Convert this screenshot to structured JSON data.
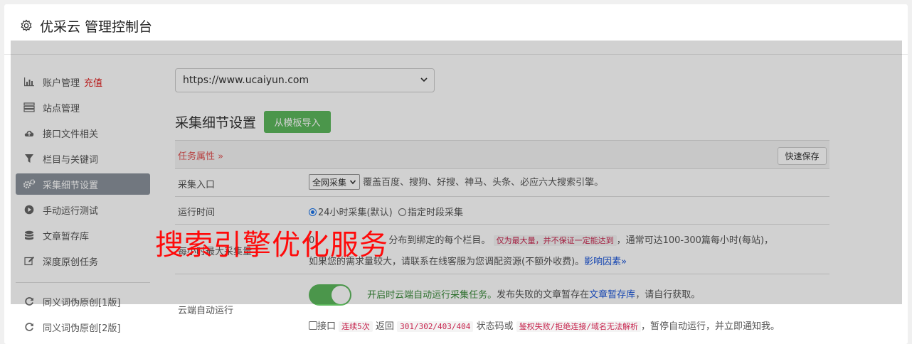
{
  "header": {
    "title": "优采云 管理控制台",
    "icon": "gear-icon"
  },
  "sidebar": {
    "recharge_label": "充值",
    "items": [
      {
        "label": "账户管理",
        "icon": "bar-chart-icon"
      },
      {
        "label": "站点管理",
        "icon": "server-icon"
      },
      {
        "label": "接口文件相关",
        "icon": "cloud-upload-icon"
      },
      {
        "label": "栏目与关键词",
        "icon": "filter-icon"
      },
      {
        "label": "采集细节设置",
        "icon": "gears-icon",
        "active": true
      },
      {
        "label": "手动运行测试",
        "icon": "play-circle-icon"
      },
      {
        "label": "文章暂存库",
        "icon": "database-icon"
      },
      {
        "label": "深度原创任务",
        "icon": "edit-icon"
      },
      {
        "label": "同义词伪原创[1版]",
        "icon": "refresh-icon"
      },
      {
        "label": "同义词伪原创[2版]",
        "icon": "refresh-icon"
      }
    ]
  },
  "main": {
    "site_select": "https://www.ucaiyun.com",
    "section_title": "采集细节设置",
    "import_button": "从模板导入",
    "props_label": "任务属性 »",
    "save_button": "快速保存",
    "entry": {
      "label": "采集入口",
      "select_value": "全网采集",
      "desc": "覆盖百度、搜狗、好搜、神马、头条、必应六大搜索引擎。"
    },
    "runtime": {
      "label": "运行时间",
      "opt1": "24小时采集(默认)",
      "opt2": "指定时段采集"
    },
    "max": {
      "label": "每小时最大采集量",
      "prefix": "0",
      "mid": "分布到绑定的每个栏目。",
      "code1": "仅为最大量，并不保证一定能达到",
      "after": "，通常可达100-300篇每小时(每站)，",
      "line2": "如果您的需求量较大，请联系在线客服为您调配资源(不额外收费)。",
      "link": "影响因素»"
    },
    "cloud": {
      "label": "云端自动运行",
      "toggle_text": "开启时云端自动运行采集任务。",
      "text2": "发布失败的文章暂存在",
      "link": "文章暂存库",
      "text3": "，请自行获取。",
      "cb_label": "接口",
      "code_times": "连续5次",
      "ret": "返回",
      "code_status": "301/302/403/404",
      "status_or": "状态码或",
      "code_err": "鉴权失败/拒绝连接/域名无法解析",
      "tail": "，暂停自动运行，并立即通知我。"
    }
  },
  "watermark": "搜索引擎优化服务",
  "colors": {
    "accent_green": "#5cb85c",
    "active_nav": "#8a929c",
    "link": "#1a55d8",
    "warn_red": "#e02020",
    "watermark_red": "#ff0a0a"
  }
}
